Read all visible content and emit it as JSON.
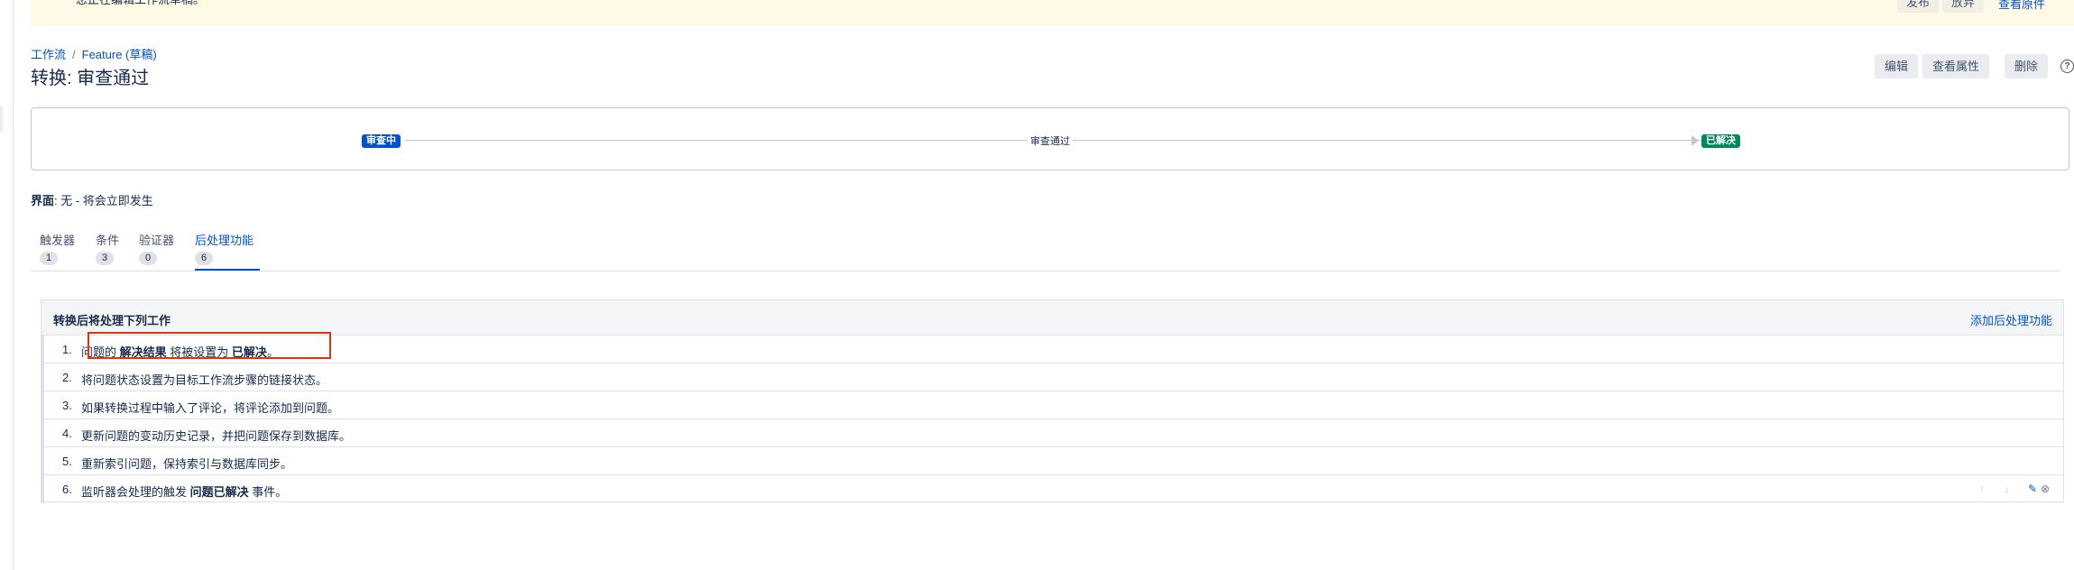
{
  "banner": {
    "text": "您正在编辑工作流草稿。",
    "buttons": [
      "发布",
      "放弃"
    ],
    "link": "查看原件"
  },
  "breadcrumb": {
    "workflow": "工作流",
    "separator": "/",
    "draft": "Feature (草稿)"
  },
  "page_title": "转换: 审查通过",
  "actions": {
    "edit": "编辑",
    "properties": "查看属性",
    "delete": "删除",
    "help": "?"
  },
  "flow": {
    "from_status": "审查中",
    "transition": "审查通过",
    "to_status": "已解决",
    "colors": {
      "from": "#0052cc",
      "to": "#00875a"
    }
  },
  "screen": {
    "label": "界面",
    "value": ": 无 - 将会立即发生"
  },
  "tabs": [
    {
      "label": "触发器",
      "count": "1"
    },
    {
      "label": "条件",
      "count": "3"
    },
    {
      "label": "验证器",
      "count": "0"
    },
    {
      "label": "后处理功能",
      "count": "6",
      "active": true
    }
  ],
  "post_functions": {
    "heading": "转换后将处理下列工作",
    "add_label": "添加后处理功能",
    "rows": [
      {
        "num": "1.",
        "pre": "问题的",
        "b1": "解决结果",
        "mid": "将被设置为",
        "b2": "已解决",
        "post": "。"
      },
      {
        "num": "2.",
        "text": "将问题状态设置为目标工作流步骤的链接状态。"
      },
      {
        "num": "3.",
        "text": "如果转换过程中输入了评论，将评论添加到问题。"
      },
      {
        "num": "4.",
        "text": "更新问题的变动历史记录，并把问题保存到数据库。"
      },
      {
        "num": "5.",
        "text": "重新索引问题，保持索引与数据库同步。"
      },
      {
        "num": "6.",
        "pre": "监听器会处理的触发",
        "b1": "问题已解决",
        "post": "事件。"
      }
    ]
  },
  "icons": {
    "up": "arrow-up-icon",
    "down": "arrow-down-icon",
    "edit": "pencil-icon",
    "delete": "remove-circle-icon"
  }
}
